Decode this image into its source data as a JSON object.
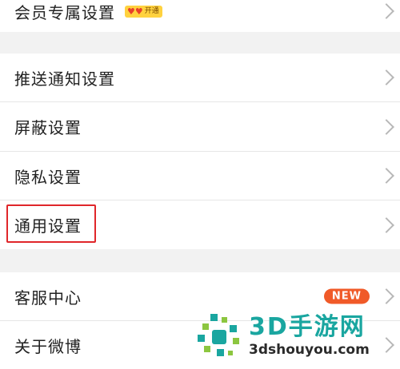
{
  "settings": {
    "vip": {
      "label": "会员专属设置",
      "badge_text": "开通"
    },
    "push": {
      "label": "推送通知设置"
    },
    "block": {
      "label": "屏蔽设置"
    },
    "privacy": {
      "label": "隐私设置"
    },
    "general": {
      "label": "通用设置"
    },
    "support": {
      "label": "客服中心",
      "badge": "NEW"
    },
    "about": {
      "label": "关于微博"
    }
  },
  "watermark": {
    "title": "3D手游网",
    "url": "3dshouyou.com"
  },
  "colors": {
    "highlight_border": "#e0262a",
    "new_badge": "#f05a28",
    "vip_badge": "#ffd23f",
    "watermark_teal": "#1aa6a0"
  }
}
